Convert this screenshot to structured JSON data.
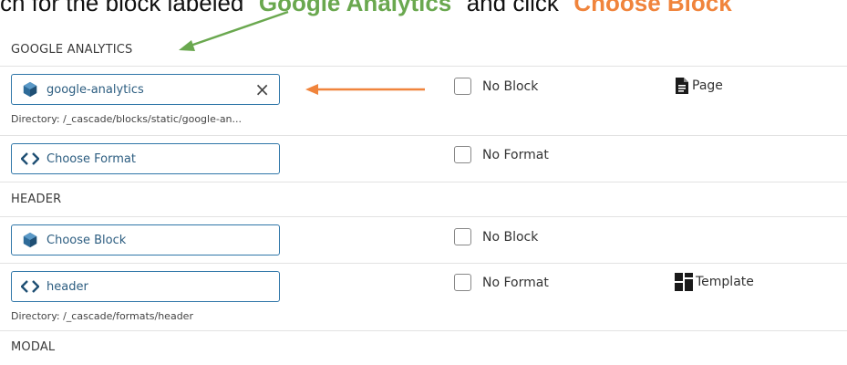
{
  "instruction": {
    "prefix": "ch for the block labeled \"",
    "highlight": "Google Analytics",
    "middle": "\" and click \"",
    "action": "Choose Block"
  },
  "sections": {
    "google_analytics": "GOOGLE ANALYTICS",
    "header": "HEADER",
    "modal": "MODAL"
  },
  "ga": {
    "block_value": "google-analytics",
    "clear_icon": "×",
    "block_directory": "Directory: /_cascade/blocks/static/google-an...",
    "no_block_label": "No Block",
    "page_label": "Page",
    "format_placeholder": "Choose Format",
    "no_format_label": "No Format"
  },
  "header": {
    "block_placeholder": "Choose Block",
    "no_block_label": "No Block",
    "format_value": "header",
    "format_directory": "Directory: /_cascade/formats/header",
    "no_format_label": "No Format",
    "template_label": "Template"
  },
  "icons": {
    "block": "cube-icon",
    "format": "code-brackets-icon",
    "page": "file-text-icon",
    "template": "template-grid-icon",
    "clear": "close-icon"
  },
  "colors": {
    "accent_border": "#2f76a8",
    "green_annotation": "#6aa84f",
    "orange_annotation": "#f0843c"
  }
}
